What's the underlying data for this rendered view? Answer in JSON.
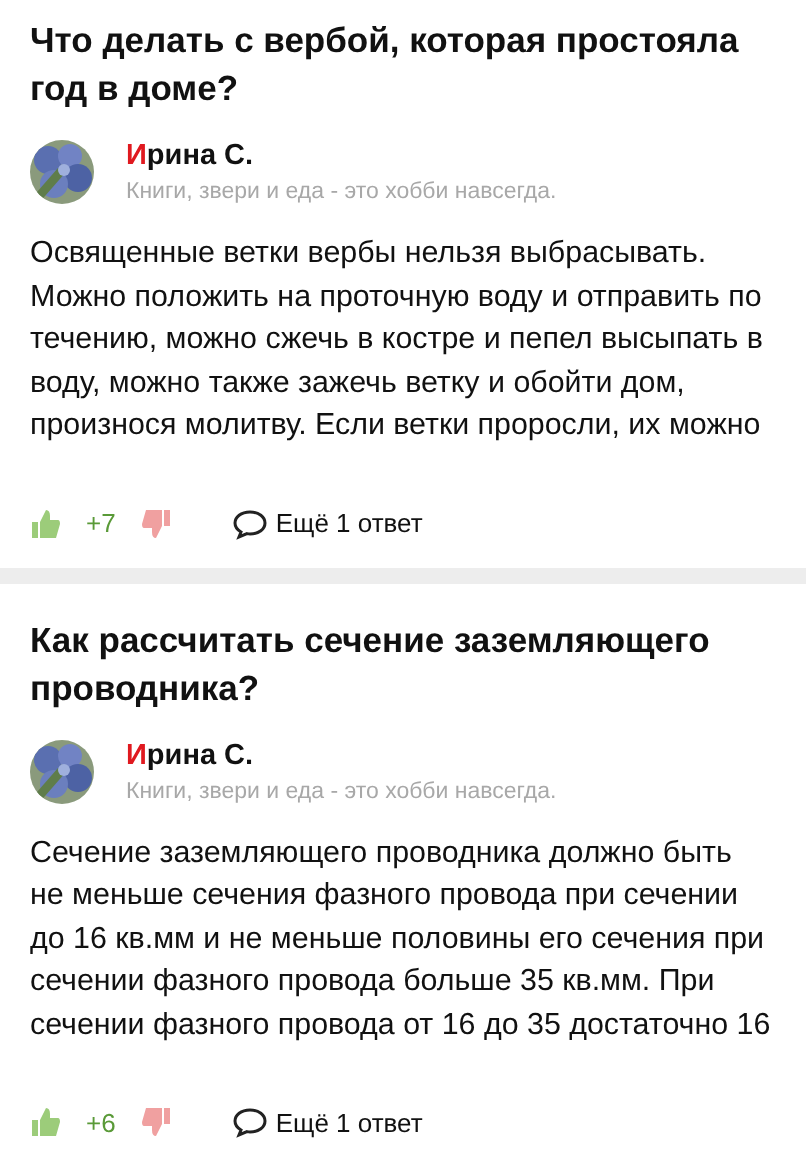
{
  "questions": [
    {
      "title": "Что делать с вербой, которая простояла год в доме?",
      "author": {
        "name": "Ирина С.",
        "bio": "Книги, звери и еда - это хобби навсегда."
      },
      "answer": "Освященные ветки вербы нельзя выбрасывать. Можно положить на проточную воду и отправить по течению, можно сжечь в костре и пепел высыпать в воду, можно также зажечь ветку и обойти дом, произнося молитву. Если ветки проросли, их можно",
      "likes": "+7",
      "more": "Ещё 1 ответ"
    },
    {
      "title": "Как рассчитать сечение заземляющего проводника?",
      "author": {
        "name": "Ирина С.",
        "bio": "Книги, звери и еда - это хобби навсегда."
      },
      "answer": "Сечение заземляющего проводника должно быть не меньше сечения фазного провода при сечении до 16 кв.мм и не меньше половины его сечения при сечении фазного провода больше 35 кв.мм. При сечении фазного провода от 16 до 35 достаточно 16",
      "likes": "+6",
      "more": "Ещё 1 ответ"
    }
  ]
}
